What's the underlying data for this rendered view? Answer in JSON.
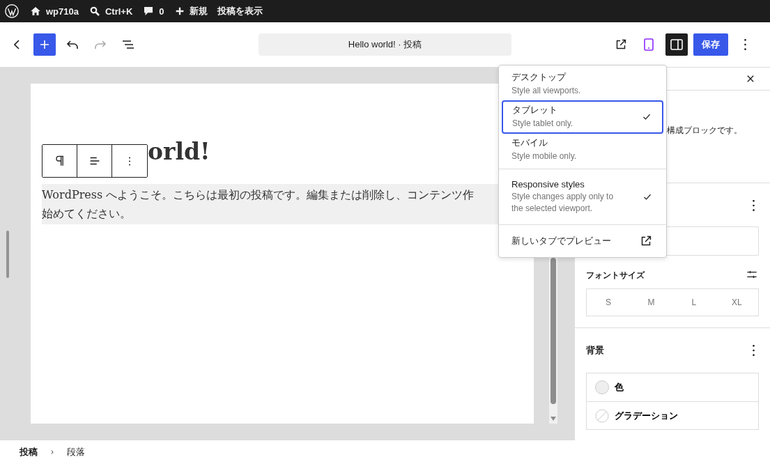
{
  "admin_bar": {
    "items": [
      {
        "kind": "logo"
      },
      {
        "kind": "site",
        "label": "wp710a"
      },
      {
        "kind": "search",
        "label": "Ctrl+K"
      },
      {
        "kind": "comments",
        "label": "0"
      },
      {
        "kind": "new",
        "label": "新規"
      },
      {
        "kind": "text",
        "label": "投稿を表示"
      }
    ]
  },
  "toolbar": {
    "document_title": "Hello world! · 投稿",
    "device_preview_active": true,
    "settings_pressed": true,
    "save": "保存"
  },
  "editor": {
    "heading": "orld!",
    "paragraph_lines": [
      "WordPress へようこそ。こちらは最初の投稿です。編集または削除し、コンテンツ作",
      "始めてください。"
    ],
    "paragraph_selected": true
  },
  "viewport_menu": {
    "devices": [
      {
        "label": "デスクトップ",
        "description": "Style all viewports.",
        "selected": false
      },
      {
        "label": "タブレット",
        "description": "Style tablet only.",
        "selected": true
      },
      {
        "label": "モバイル",
        "description": "Style mobile only.",
        "selected": false
      }
    ],
    "responsive": {
      "label": "Responsive styles",
      "description": "Style changes apply only to the selected viewport.",
      "checked": true
    },
    "preview_link": "新しいタブでプレビュー"
  },
  "sidebar": {
    "note": "構成ブロックです。",
    "font_size": {
      "label": "フォントサイズ",
      "sizes": [
        "S",
        "M",
        "L",
        "XL"
      ]
    },
    "background": {
      "title": "背景",
      "items": [
        {
          "kind": "color",
          "label": "色"
        },
        {
          "kind": "gradient",
          "label": "グラデーション"
        }
      ]
    }
  },
  "breadcrumb": [
    "投稿",
    "段落"
  ]
}
